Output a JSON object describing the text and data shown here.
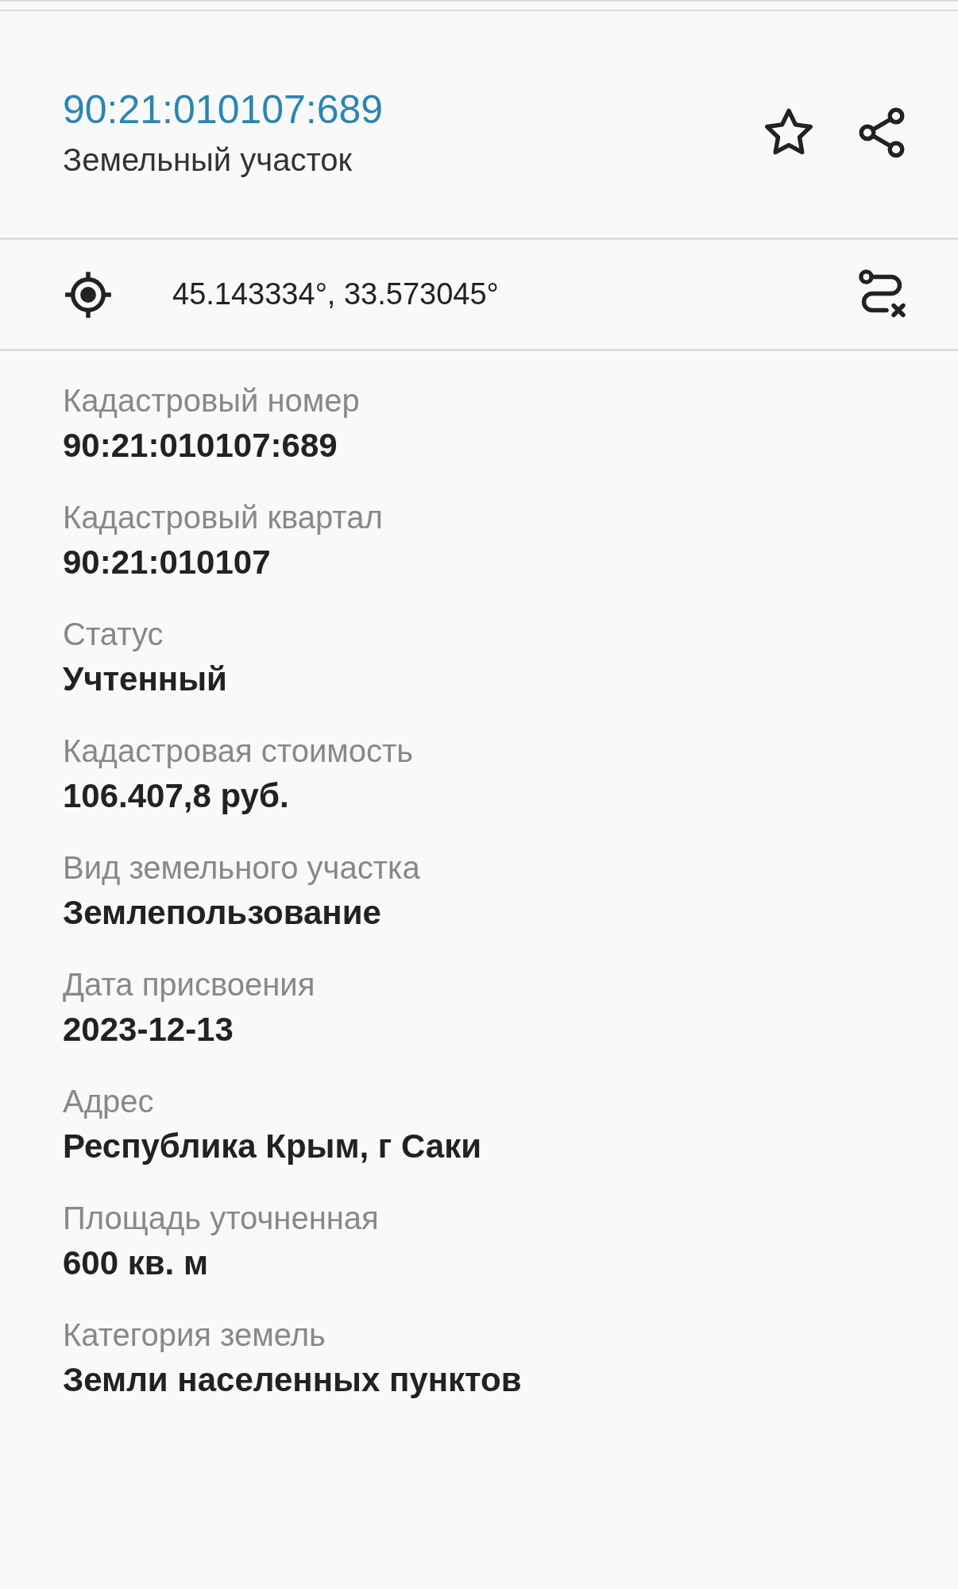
{
  "header": {
    "title": "90:21:010107:689",
    "subtitle": "Земельный участок"
  },
  "location": {
    "coordinates": "45.143334°, 33.573045°"
  },
  "fields": [
    {
      "label": "Кадастровый номер",
      "value": "90:21:010107:689"
    },
    {
      "label": "Кадастровый квартал",
      "value": "90:21:010107"
    },
    {
      "label": "Статус",
      "value": "Учтенный"
    },
    {
      "label": "Кадастровая стоимость",
      "value": "106.407,8 руб."
    },
    {
      "label": "Вид земельного участка",
      "value": "Землепользование"
    },
    {
      "label": "Дата присвоения",
      "value": "2023-12-13"
    },
    {
      "label": "Адрес",
      "value": "Республика Крым, г Саки"
    },
    {
      "label": "Площадь уточненная",
      "value": "600 кв. м"
    },
    {
      "label": "Категория земель",
      "value": "Земли населенных пунктов"
    }
  ]
}
